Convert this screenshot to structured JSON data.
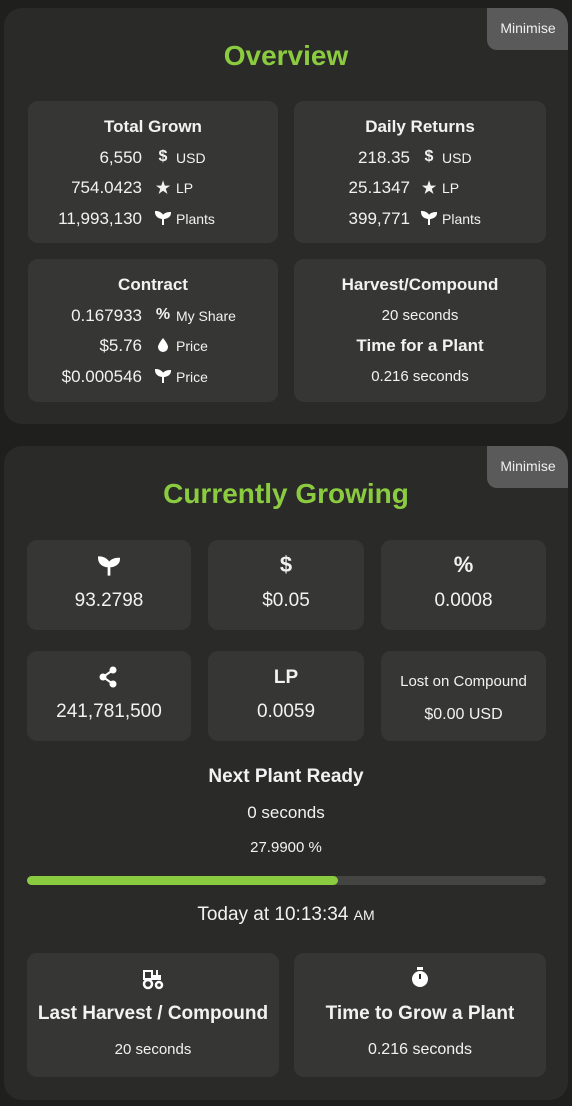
{
  "overview": {
    "title": "Overview",
    "minimise_label": "Minimise",
    "total_grown": {
      "title": "Total Grown",
      "rows": [
        {
          "value": "6,550",
          "icon": "dollar-icon",
          "unit": "USD"
        },
        {
          "value": "754.0423",
          "icon": "star-icon",
          "unit": "LP"
        },
        {
          "value": "11,993,130",
          "icon": "sprout-icon",
          "unit": "Plants"
        }
      ]
    },
    "daily_returns": {
      "title": "Daily Returns",
      "rows": [
        {
          "value": "218.35",
          "icon": "dollar-icon",
          "unit": "USD"
        },
        {
          "value": "25.1347",
          "icon": "star-icon",
          "unit": "LP"
        },
        {
          "value": "399,771",
          "icon": "sprout-icon",
          "unit": "Plants"
        }
      ]
    },
    "contract": {
      "title": "Contract",
      "rows": [
        {
          "value": "0.167933",
          "icon": "percent-icon",
          "unit": "My Share"
        },
        {
          "value": "$5.76",
          "icon": "droplet-icon",
          "unit": "Price"
        },
        {
          "value": "$0.000546",
          "icon": "sprout-icon",
          "unit": "Price"
        }
      ]
    },
    "harvest": {
      "title": "Harvest/Compound",
      "value": "20 seconds",
      "title2": "Time for a Plant",
      "value2": "0.216 seconds"
    }
  },
  "growing": {
    "title": "Currently Growing",
    "minimise_label": "Minimise",
    "cards": {
      "plants": {
        "icon": "sprout-icon",
        "value": "93.2798"
      },
      "dollar": {
        "icon": "dollar-icon",
        "value": "$0.05"
      },
      "percent": {
        "icon": "percent-icon",
        "value": "0.0008"
      },
      "share": {
        "icon": "share-icon",
        "value": "241,781,500"
      },
      "lp": {
        "label": "LP",
        "value": "0.0059"
      },
      "lost": {
        "label": "Lost on Compound",
        "value": "$0.00 USD"
      }
    },
    "next_plant": {
      "title": "Next Plant Ready",
      "time": "0 seconds",
      "percent_text": "27.9900 %",
      "progress_fraction": 0.6
    },
    "timestamp": "Today at 10:13:34",
    "timestamp_suffix": "AM",
    "last_harvest": {
      "icon": "tractor-icon",
      "title": "Last Harvest / Compound",
      "value": "20 seconds"
    },
    "time_to_grow": {
      "icon": "stopwatch-icon",
      "title": "Time to Grow a Plant",
      "value": "0.216 seconds"
    }
  },
  "colors": {
    "accent": "#8bcb3f",
    "panel": "#2a2a29",
    "card": "#363635",
    "background": "#1f1f1d"
  }
}
